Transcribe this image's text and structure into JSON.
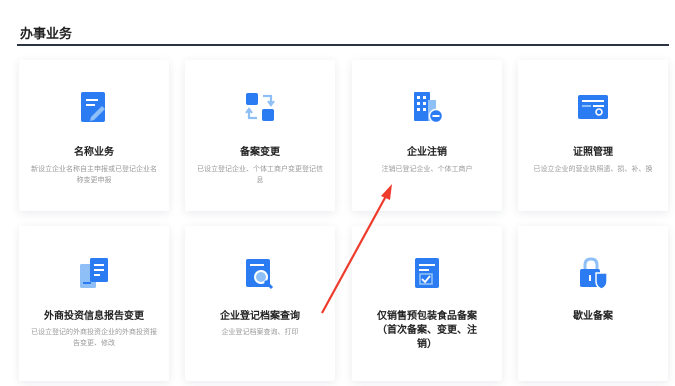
{
  "section": {
    "title": "办事业务"
  },
  "cards": [
    {
      "title": "名称业务",
      "desc": "新设立企业名称自主申报或已登记企业名称变更申报",
      "icon": "document-edit-icon"
    },
    {
      "title": "备案变更",
      "desc": "已设立登记企业、个体工商户变更登记信息",
      "icon": "swap-arrows-icon"
    },
    {
      "title": "企业注销",
      "desc": "注销已登记企业、个体工商户",
      "icon": "building-minus-icon"
    },
    {
      "title": "证照管理",
      "desc": "已设立企业的营业执照遗、损、补、换",
      "icon": "license-card-icon"
    },
    {
      "title": "外商投资信息报告变更",
      "desc": "已设立登记的外商投资企业的外商投资报告变更、修改",
      "icon": "documents-icon"
    },
    {
      "title": "企业登记档案查询",
      "desc": "企业登记档案查询、打印",
      "icon": "document-search-icon"
    },
    {
      "title": "仅销售预包装食品备案（首次备案、变更、注销）",
      "desc": "",
      "icon": "checklist-icon"
    },
    {
      "title": "歇业备案",
      "desc": "",
      "icon": "lock-shield-icon"
    }
  ],
  "colors": {
    "accent": "#2b7cf2",
    "accent_light": "#8ec0f7",
    "annotation": "#ee3b2c"
  }
}
